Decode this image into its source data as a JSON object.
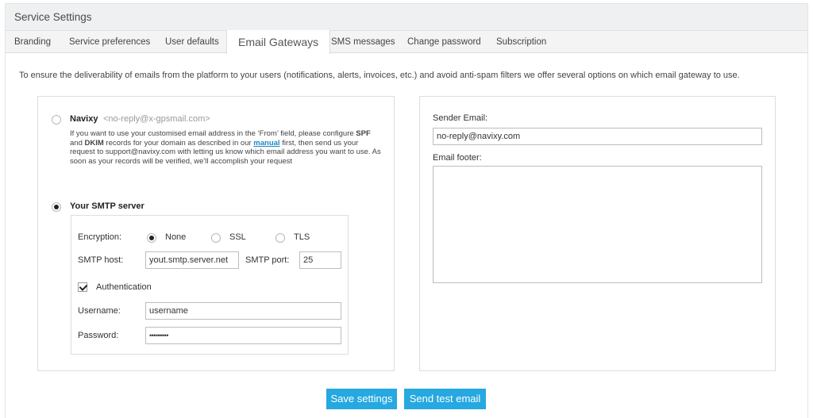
{
  "window": {
    "title": "Service Settings"
  },
  "tabs": [
    {
      "label": "Branding"
    },
    {
      "label": "Service preferences"
    },
    {
      "label": "User defaults"
    },
    {
      "label": "Email Gateways",
      "active": true
    },
    {
      "label": "SMS messages"
    },
    {
      "label": "Change password"
    },
    {
      "label": "Subscription"
    }
  ],
  "description": "To ensure the deliverability of emails from the platform to your users (notifications, alerts, invoices, etc.) and avoid anti-spam filters we offer several options on which email gateway to use.",
  "gateway": {
    "navixy": {
      "label": "Navixy",
      "address": "<no-reply@x-gpsmail.com>",
      "selected": false,
      "note": {
        "part1": "If you want to use your customised email address in the ‘From’ field, please configure ",
        "spf": "SPF",
        "and": " and ",
        "dkim": "DKIM",
        "part2": " records for your domain as described in our ",
        "link": "manual",
        "part3": " first, then send us your request to support@navixy.com with letting us know which email address you want to use. As soon as your records will be verified, we'll accomplish your request"
      }
    },
    "smtp": {
      "label": "Your SMTP server",
      "selected": true,
      "encryption_label": "Encryption:",
      "encryption_options": [
        "None",
        "SSL",
        "TLS"
      ],
      "encryption_selected": "None",
      "host_label": "SMTP host:",
      "host_value": "yout.smtp.server.net",
      "port_label": "SMTP port:",
      "port_value": "25",
      "auth_label": "Authentication",
      "auth_checked": true,
      "username_label": "Username:",
      "username_value": "username",
      "password_label": "Password:",
      "password_value": "•••••••••"
    }
  },
  "sender": {
    "email_label": "Sender Email:",
    "email_value": "no-reply@navixy.com",
    "footer_label": "Email footer:",
    "footer_value": ""
  },
  "actions": {
    "save_label": "Save settings",
    "test_label": "Send test email"
  },
  "colors": {
    "accent": "#26a8e0",
    "link": "#1e88c8"
  }
}
